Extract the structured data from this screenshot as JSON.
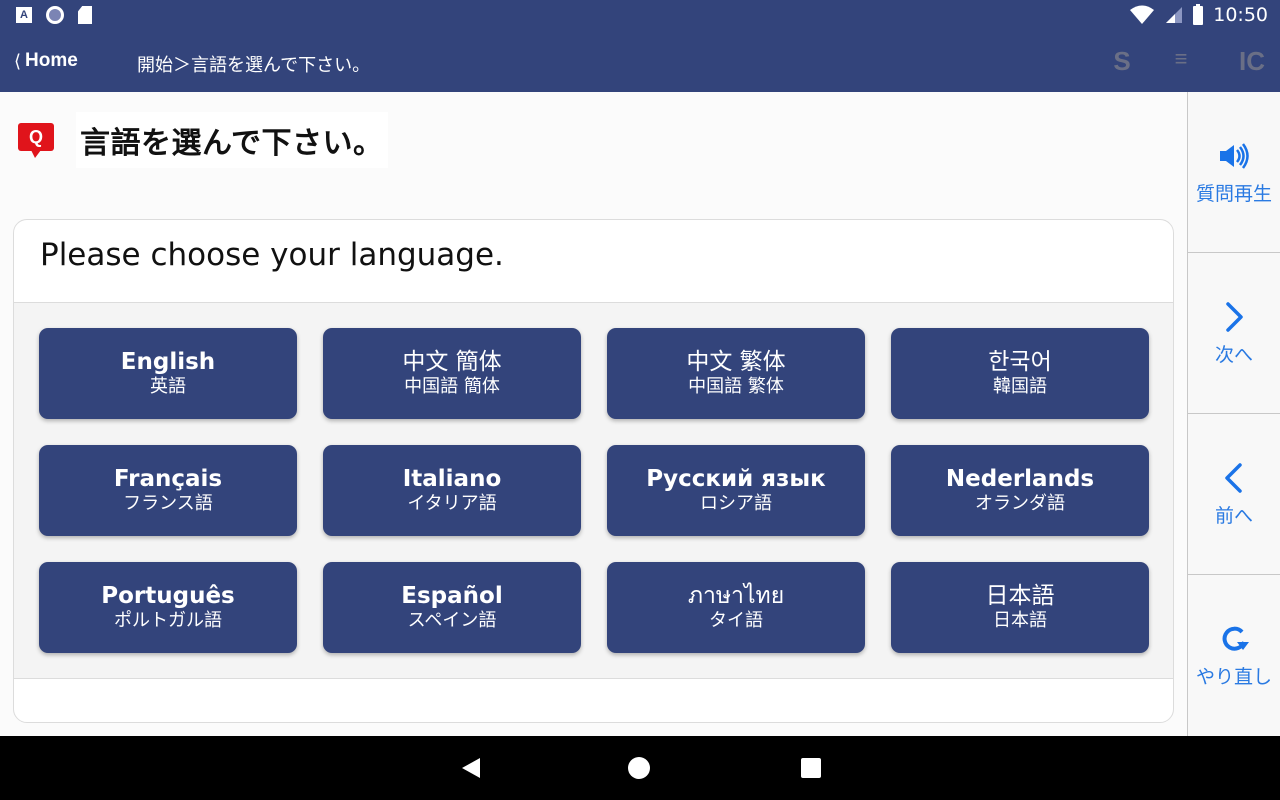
{
  "status_bar": {
    "time": "10:50",
    "icons": [
      "accessibility-a-icon",
      "circle-record-icon",
      "sd-card-icon",
      "wifi-icon",
      "signal-icon",
      "battery-icon"
    ]
  },
  "toolbar": {
    "home_label": "Home",
    "home_chevron": "⟨",
    "breadcrumb": "開始＞言語を選んで下さい。",
    "s_label": "S",
    "menu_label": "≡",
    "ic_label": "IC"
  },
  "question": {
    "badge": "Q",
    "title": "言語を選んで下さい。"
  },
  "card": {
    "prompt": "Please choose your language."
  },
  "languages": [
    {
      "native": "English",
      "ja": "英語"
    },
    {
      "native": "中文 簡体",
      "ja": "中国語 簡体"
    },
    {
      "native": "中文 繁体",
      "ja": "中国語 繁体"
    },
    {
      "native": "한국어",
      "ja": "韓国語"
    },
    {
      "native": "Français",
      "ja": "フランス語"
    },
    {
      "native": "Italiano",
      "ja": "イタリア語"
    },
    {
      "native": "Русский язык",
      "ja": "ロシア語"
    },
    {
      "native": "Nederlands",
      "ja": "オランダ語"
    },
    {
      "native": "Português",
      "ja": "ポルトガル語"
    },
    {
      "native": "Español",
      "ja": "スペイン語"
    },
    {
      "native": "ภาษาไทย",
      "ja": "タイ語"
    },
    {
      "native": "日本語",
      "ja": "日本語"
    }
  ],
  "side_panel": {
    "replay_label": "質問再生",
    "next_label": "次へ",
    "prev_label": "前へ",
    "redo_label": "やり直し"
  },
  "colors": {
    "primary": "#33447b",
    "accent_blue": "#1a73e8",
    "q_red": "#e0141b"
  }
}
